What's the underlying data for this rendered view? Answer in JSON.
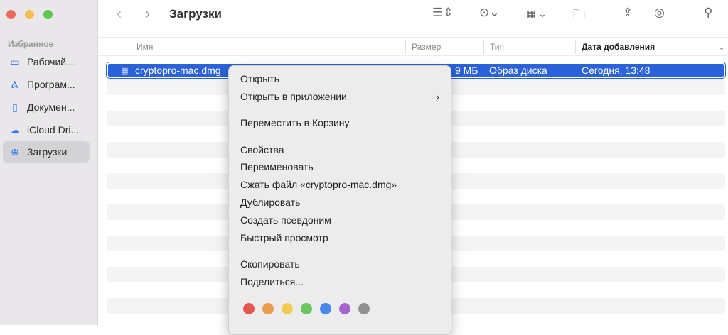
{
  "window": {
    "title": "Загрузки"
  },
  "sidebar": {
    "section": "Избранное",
    "items": [
      {
        "label": "Рабочий...",
        "icon": "desktop-icon"
      },
      {
        "label": "Програм...",
        "icon": "applications-icon"
      },
      {
        "label": "Докумен...",
        "icon": "document-icon"
      },
      {
        "label": "iCloud Dri...",
        "icon": "cloud-icon"
      },
      {
        "label": "Загрузки",
        "icon": "download-icon"
      }
    ]
  },
  "columns": {
    "name": "Имя",
    "size": "Размер",
    "type": "Тип",
    "date": "Дата добавления"
  },
  "file": {
    "name": "cryptopro-mac.dmg",
    "size": "9 МБ",
    "type": "Образ диска",
    "date": "Сегодня, 13:48"
  },
  "menu": {
    "items": [
      "Открыть",
      "Открыть в приложении",
      "Переместить в Корзину",
      "Свойства",
      "Переименовать",
      "Сжать файл «cryptopro-mac.dmg»",
      "Дублировать",
      "Создать псевдоним",
      "Быстрый просмотр",
      "Скопировать",
      "Поделиться..."
    ],
    "tag_colors": [
      "#e8574f",
      "#ec9e4f",
      "#f2cc52",
      "#6cc763",
      "#4a86f0",
      "#a664cf",
      "#919191"
    ]
  }
}
